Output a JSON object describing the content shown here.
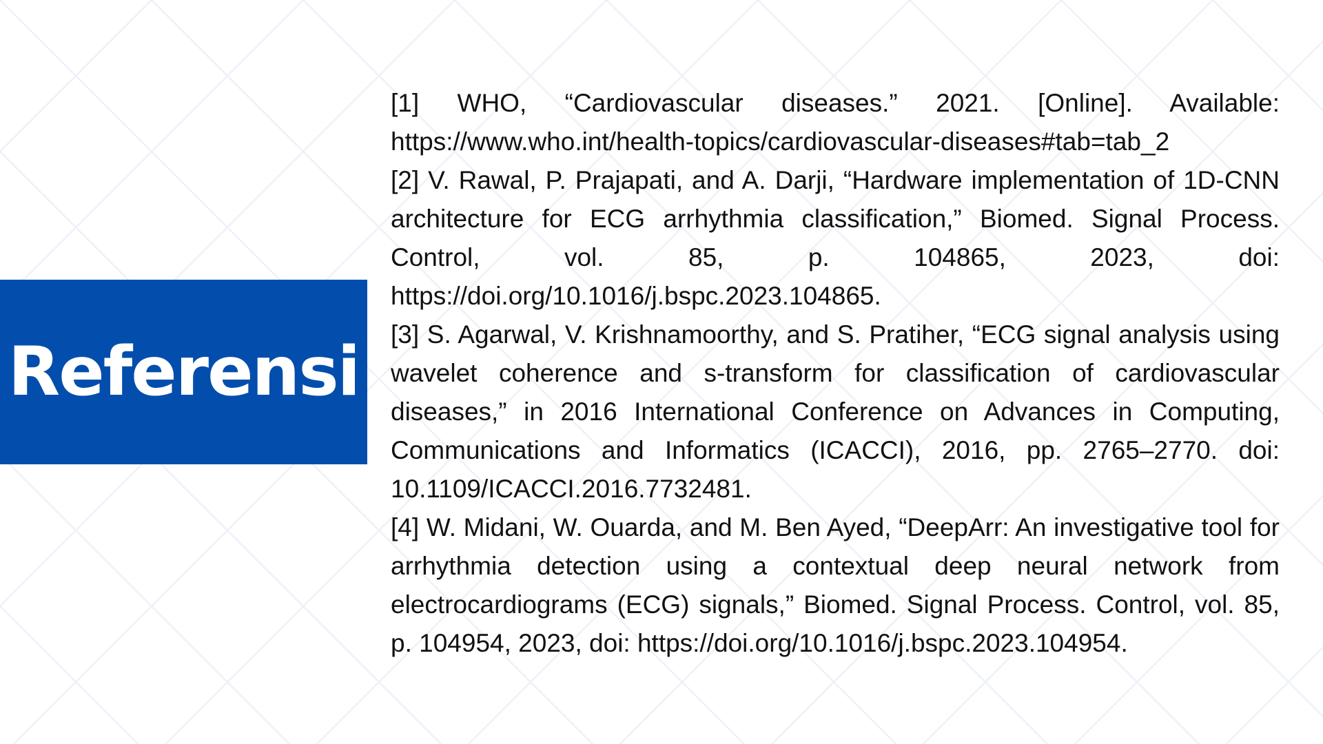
{
  "colors": {
    "accent": "#034ead",
    "text": "#111111",
    "background": "#ffffff",
    "pattern": "#eef1f8"
  },
  "title": "Referensi",
  "references": [
    "[1] WHO, “Cardiovascular diseases.” 2021. [Online]. Available: https://www.who.int/health-topics/cardiovascular-diseases#tab=tab_2",
    "[2] V. Rawal, P. Prajapati, and A. Darji, “Hardware implementation of 1D-CNN architecture for ECG arrhythmia classification,” Biomed. Signal Process. Control, vol. 85, p. 104865, 2023, doi: https://doi.org/10.1016/j.bspc.2023.104865.",
    "[3] S. Agarwal, V. Krishnamoorthy, and S. Pratiher, “ECG signal analysis using wavelet coherence and s-transform for classification of cardiovascular diseases,” in 2016 International Conference on Advances in Computing, Communications and Informatics (ICACCI), 2016, pp. 2765–2770. doi: 10.1109/ICACCI.2016.7732481.",
    "[4] W. Midani, W. Ouarda, and M. Ben Ayed, “DeepArr: An investigative tool for arrhythmia detection using a contextual deep neural network from electrocardiograms (ECG) signals,” Biomed. Signal Process. Control, vol. 85, p. 104954, 2023, doi: https://doi.org/10.1016/j.bspc.2023.104954."
  ]
}
